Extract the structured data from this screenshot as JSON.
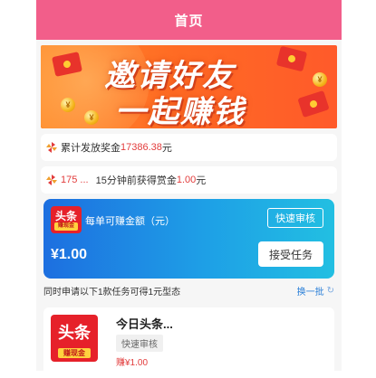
{
  "header": {
    "title": "首页"
  },
  "banner": {
    "line1": "邀请好友",
    "line2": "一起赚钱",
    "coin_glyph": "¥"
  },
  "stats": {
    "total_label": "累计发放奖金",
    "total_value": "17386.38",
    "total_unit": "元",
    "recent_user": "175 ...",
    "recent_text": "15分钟前获得赏金",
    "recent_value": "1.00",
    "recent_unit": "元"
  },
  "task_card": {
    "logo_text": "头条",
    "logo_sub": "赚现金",
    "per_label": "每单可赚金额（元）",
    "review_label": "快速审核",
    "amount": "¥1.00",
    "accept_label": "接受任务"
  },
  "notice": {
    "text": "同时申请以下1款任务可得1元型态",
    "refresh_label": "换一批",
    "refresh_icon": "refresh-icon"
  },
  "list": [
    {
      "logo_text": "头条",
      "logo_sub": "赚现金",
      "name": "今日头条...",
      "tag": "快速审核",
      "reward": "赚¥1.00"
    }
  ],
  "colors": {
    "header": "#f25e8a",
    "banner": "#ff6b24",
    "card_start": "#1d6fe0",
    "card_end": "#22bfe2",
    "highlight": "#e23c3c",
    "link": "#2a7fd8"
  }
}
